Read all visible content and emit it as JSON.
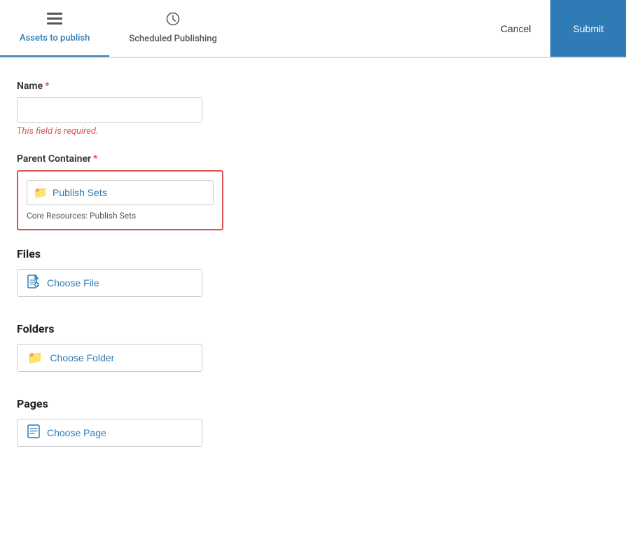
{
  "header": {
    "tabs": [
      {
        "id": "assets",
        "label": "Assets to publish",
        "icon": "≡",
        "active": true
      },
      {
        "id": "scheduled",
        "label": "Scheduled Publishing",
        "icon": "🕐",
        "active": false
      }
    ],
    "cancel_label": "Cancel",
    "submit_label": "Submit"
  },
  "form": {
    "name_label": "Name",
    "name_required": "*",
    "name_error": "This field is required.",
    "name_placeholder": "",
    "parent_container_label": "Parent Container",
    "parent_container_required": "*",
    "parent_container_value": "Publish Sets",
    "parent_container_path": "Core Resources: Publish Sets",
    "files_heading": "Files",
    "choose_file_label": "Choose File",
    "folders_heading": "Folders",
    "choose_folder_label": "Choose Folder",
    "pages_heading": "Pages",
    "choose_page_label": "Choose Page"
  }
}
